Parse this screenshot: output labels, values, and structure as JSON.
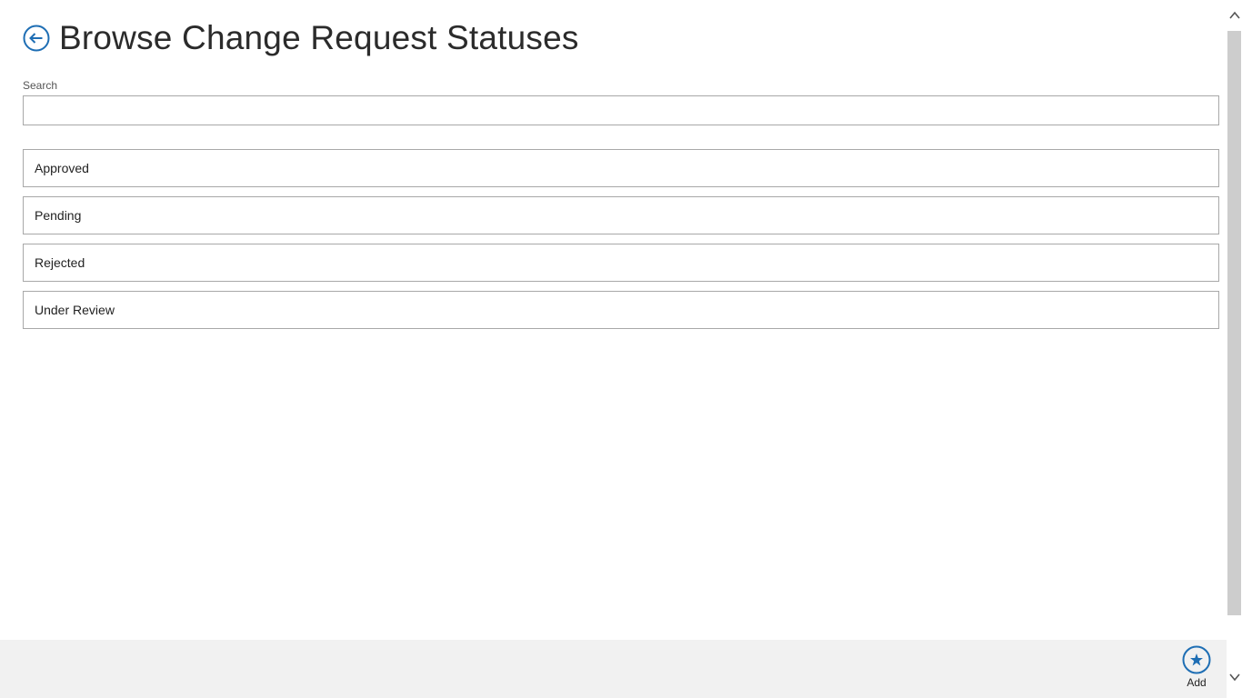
{
  "header": {
    "title": "Browse Change Request Statuses",
    "back_icon": "back-arrow-circle-icon"
  },
  "search": {
    "label": "Search",
    "value": "",
    "placeholder": ""
  },
  "statuses": [
    {
      "label": "Approved"
    },
    {
      "label": "Pending"
    },
    {
      "label": "Rejected"
    },
    {
      "label": "Under Review"
    }
  ],
  "app_bar": {
    "add_label": "Add",
    "add_icon": "star-circle-icon"
  },
  "colors": {
    "accent": "#1e6eb4",
    "app_bar_bg": "#f1f1f1",
    "scrollbar_thumb": "#cdcdcd"
  }
}
